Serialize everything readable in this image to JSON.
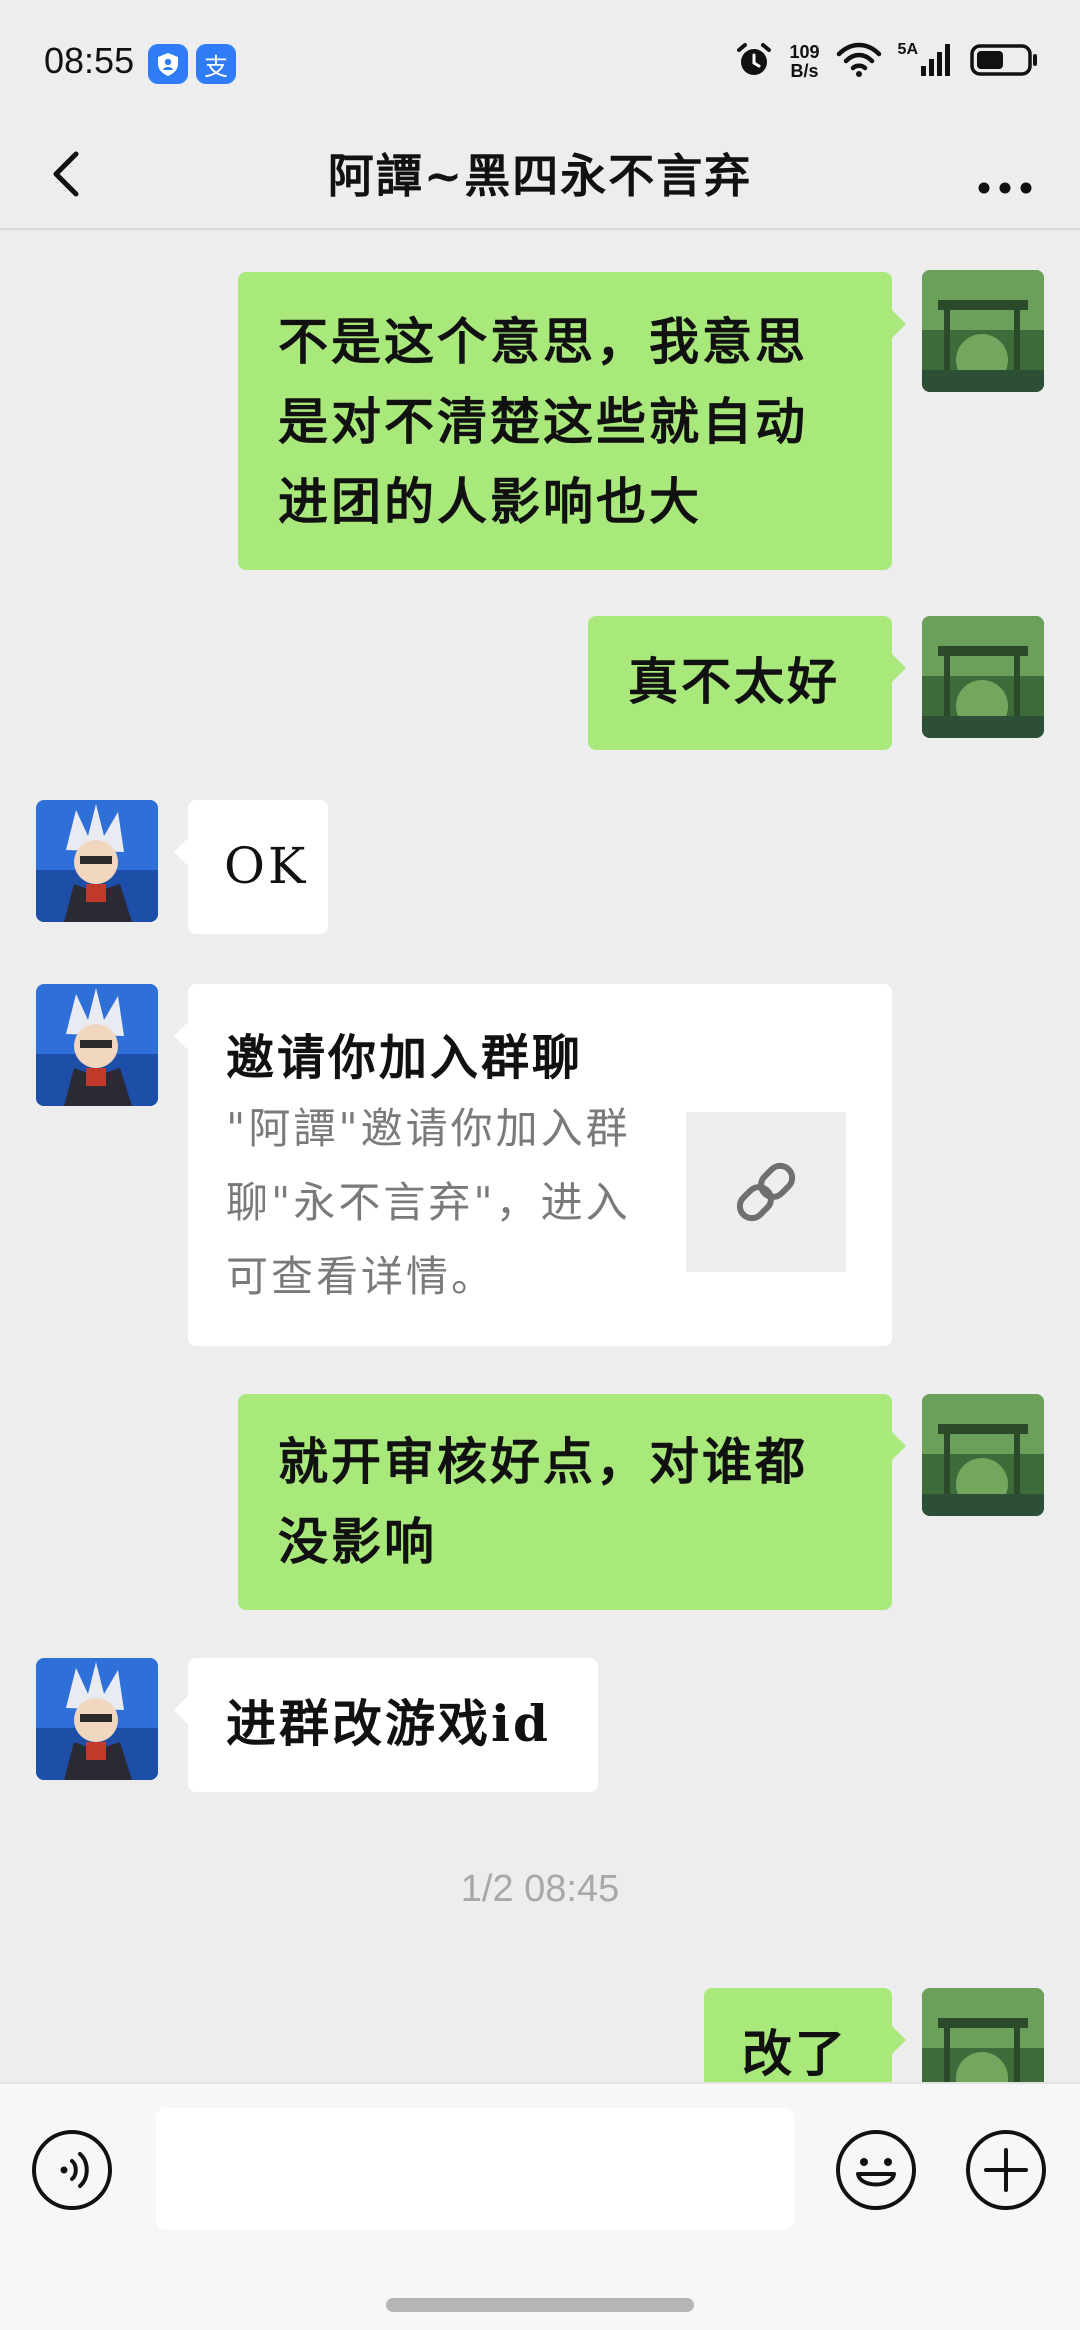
{
  "status_bar": {
    "time": "08:55",
    "app_icons": [
      "shield-app-icon",
      "alipay-icon"
    ],
    "alipay_glyph": "支",
    "net_speed_value": "109",
    "net_speed_unit": "B/s",
    "signal_label": "5A",
    "battery_level": 0.55
  },
  "header": {
    "title": "阿譚~黑四永不言弃"
  },
  "messages": [
    {
      "side": "right",
      "text": "不是这个意思，我意思是对不清楚这些就自动进团的人影响也大"
    },
    {
      "side": "right",
      "text": "真不太好"
    },
    {
      "side": "left",
      "text": "OK"
    },
    {
      "side": "left",
      "type": "invite",
      "title": "邀请你加入群聊",
      "desc": "\"阿譚\"邀请你加入群聊\"永不言弃\"，进入可查看详情。"
    },
    {
      "side": "right",
      "text": "就开审核好点，对谁都没影响"
    },
    {
      "side": "left",
      "text": "进群改游戏id"
    },
    {
      "side": "right",
      "text": "改了"
    }
  ],
  "timestamp": "1/2 08:45",
  "input_bar": {
    "placeholder": ""
  },
  "colors": {
    "background": "#ededed",
    "own_bubble": "#a9e97b",
    "other_bubble": "#ffffff",
    "timestamp_text": "#a8a8a8"
  }
}
